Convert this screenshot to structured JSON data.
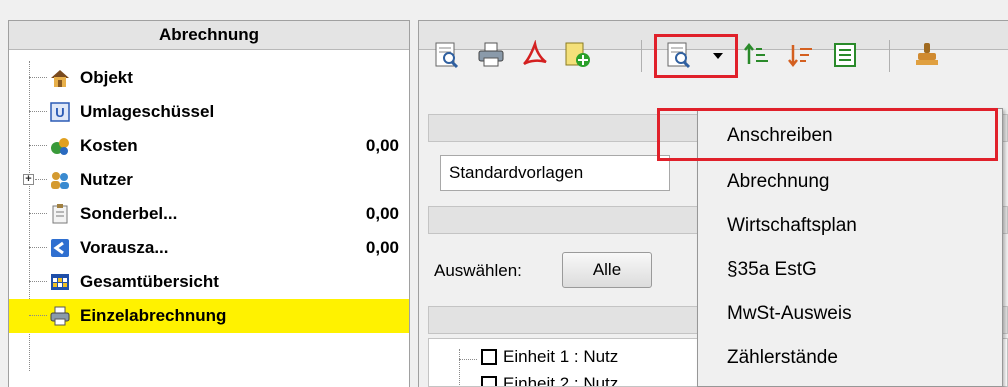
{
  "left_panel": {
    "title": "Abrechnung",
    "items": [
      {
        "label": "Objekt",
        "value": "",
        "icon": "house-icon"
      },
      {
        "label": "Umlageschüssel",
        "value": "",
        "icon": "u-key-icon"
      },
      {
        "label": "Kosten",
        "value": "0,00",
        "icon": "money-bag-icon"
      },
      {
        "label": "Nutzer",
        "value": "",
        "icon": "users-icon"
      },
      {
        "label": "Sonderbel...",
        "value": "0,00",
        "icon": "clipboard-icon"
      },
      {
        "label": "Vorausza...",
        "value": "0,00",
        "icon": "blue-arrow-icon"
      },
      {
        "label": "Gesamtübersicht",
        "value": "",
        "icon": "table-grid-icon"
      },
      {
        "label": "Einzelabrechnung",
        "value": "",
        "icon": "printer-icon"
      }
    ]
  },
  "right_panel": {
    "template_combo_value": "Standardvorlagen",
    "select_label": "Auswählen:",
    "select_all_button": "Alle",
    "units": [
      "Einheit 1 : Nutz",
      "Einheit 2 : Nutz"
    ]
  },
  "dropdown_menu": {
    "items": [
      "Anschreiben",
      "Abrechnung",
      "Wirtschaftsplan",
      "§35a EstG",
      "MwSt-Ausweis",
      "Zählerstände"
    ],
    "highlighted": "Anschreiben"
  },
  "colors": {
    "selected_row": "#fff200",
    "highlight_border": "#e0202a"
  }
}
